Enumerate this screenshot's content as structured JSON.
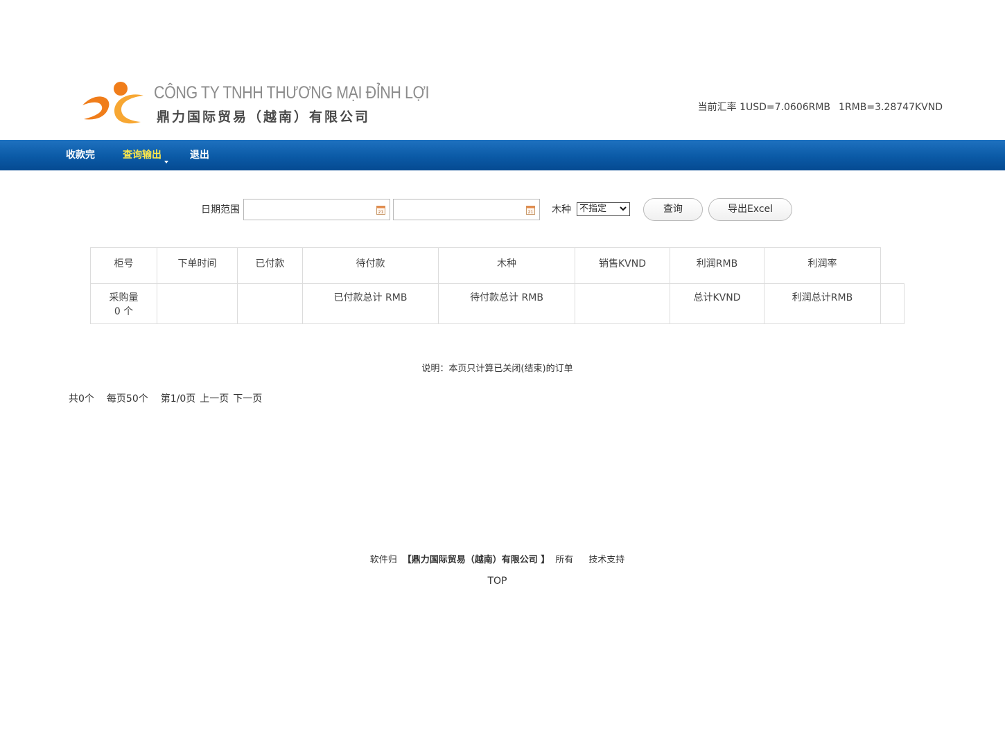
{
  "header": {
    "company_vn": "CÔNG TY TNHH THƯƠNG MẠI ĐỈNH LỢI",
    "company_cn": "鼎力国际贸易（越南）有限公司",
    "rate_usd": "当前汇率 1USD=7.0606RMB",
    "rate_rmb": "1RMB=3.28747KVND",
    "logo_colors": {
      "orange": "#f07d1a",
      "light_orange": "#f7a733"
    }
  },
  "nav": {
    "items": [
      {
        "label": "收款完"
      },
      {
        "label": "查询输出",
        "active": true,
        "has_dropdown": true
      },
      {
        "label": "退出"
      }
    ],
    "bar_color": "#0b5aa6",
    "active_color": "#ffe94a"
  },
  "search": {
    "date_label": "日期范围",
    "date_from": "",
    "date_to": "",
    "wood_label": "木种",
    "wood_selected": "不指定",
    "query_button": "查询",
    "export_button": "导出Excel"
  },
  "table": {
    "headers": [
      "柜号",
      "下单时间",
      "已付款",
      "待付款",
      "木种",
      "销售KVND",
      "利润RMB",
      "利润率"
    ],
    "summary": {
      "purchase_label": "采购量",
      "purchase_value": "0 个",
      "paid_total": "已付款总计 RMB",
      "unpaid_total": "待付款总计 RMB",
      "total_kvnd": "总计KVND",
      "profit_total": "利润总计RMB"
    }
  },
  "note": "说明：本页只计算已关闭(结束)的订单",
  "pager": {
    "total": "共0个",
    "per_page": "每页50个",
    "page": "第1/0页",
    "prev": "上一页",
    "next": "下一页"
  },
  "footer": {
    "prefix": "软件归",
    "company": "【鼎力国际贸易（越南）有限公司 】",
    "suffix": "所有",
    "support": "技术支持",
    "top": "TOP"
  }
}
